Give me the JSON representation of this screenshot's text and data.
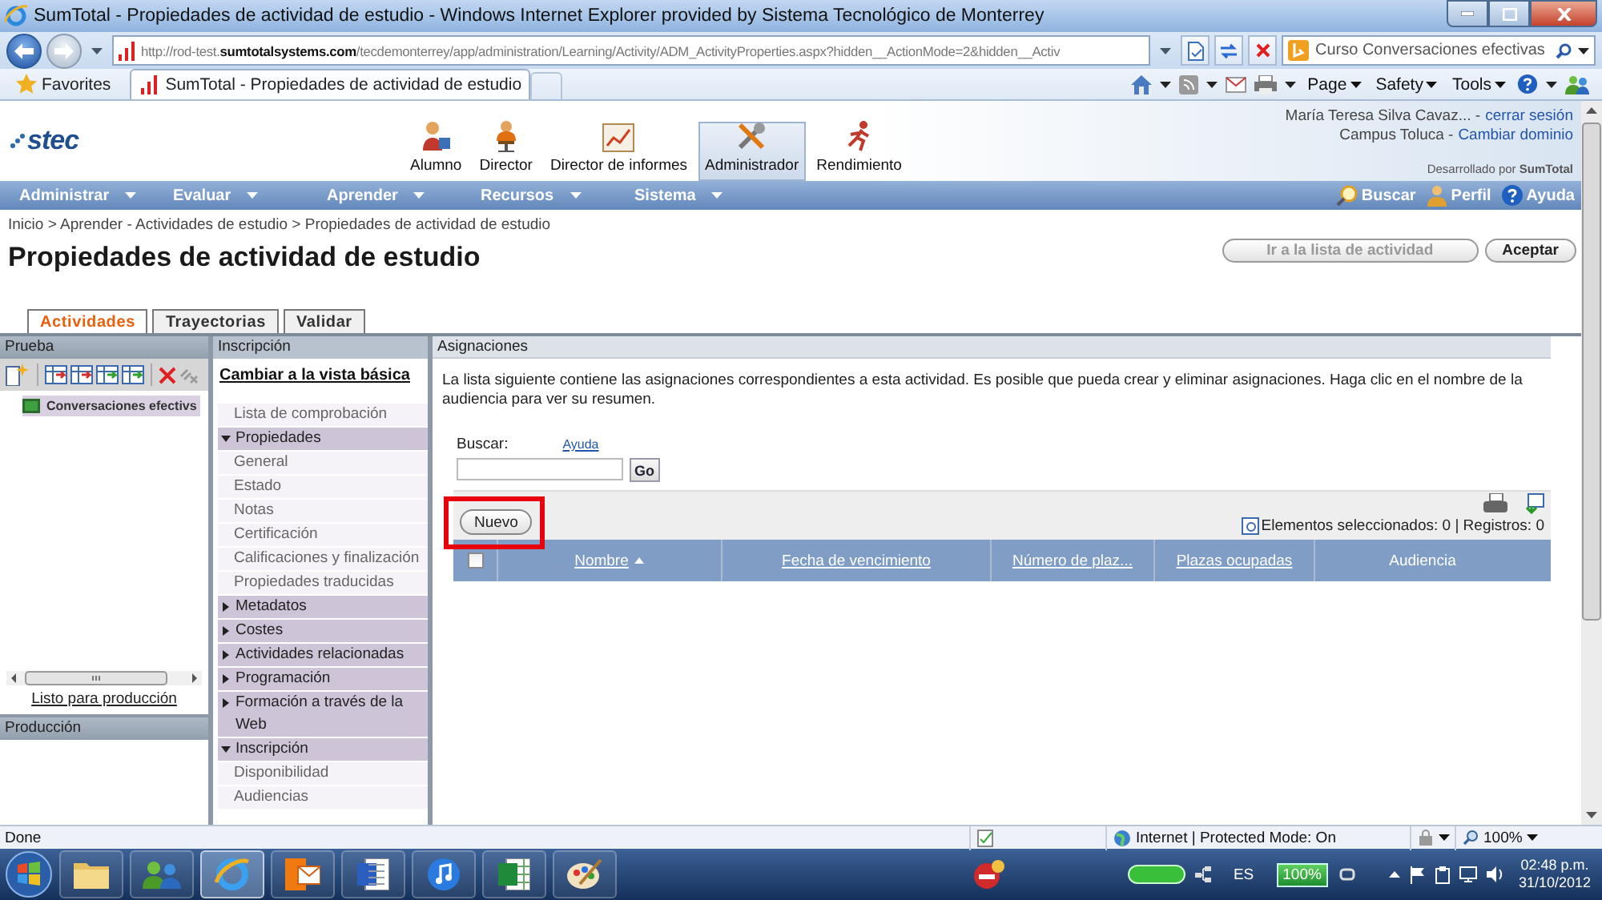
{
  "window": {
    "title": "SumTotal - Propiedades de actividad de estudio - Windows Internet Explorer provided by Sistema Tecnológico de Monterrey"
  },
  "address_bar": {
    "url": "http://rod-test.**sumtotalsystems.com**/tecdemonterrey/app/administration/Learning/Activity/ADM_ActivityProperties.aspx?hidden__ActionMode=2&hidden__Activ"
  },
  "search_box": {
    "value": "Curso Conversaciones efectivas"
  },
  "favorites": {
    "label": "Favorites"
  },
  "browser_tabs": [
    {
      "title": "SumTotal - Propiedades de actividad de estudio",
      "selected": true
    }
  ],
  "command_bar": [
    {
      "label": "Page"
    },
    {
      "label": "Safety"
    },
    {
      "label": "Tools"
    }
  ],
  "header": {
    "logo": "stec",
    "roles": [
      {
        "kind": "learner",
        "label": "Alumno",
        "selected": false
      },
      {
        "kind": "director",
        "label": "Director",
        "selected": false
      },
      {
        "kind": "reports",
        "label": "Director de informes",
        "selected": false
      },
      {
        "kind": "admin",
        "label": "Administrador",
        "selected": true
      },
      {
        "kind": "performance",
        "label": "Rendimiento",
        "selected": false
      }
    ],
    "user_name": "María Teresa Silva Cavaz... -",
    "logout": "cerrar sesión",
    "campus": "Campus Toluca -",
    "change_domain": "Cambiar dominio",
    "powered_by": "Desarrollado por **SumTotal**"
  },
  "nav_menu": [
    {
      "label": "Administrar"
    },
    {
      "label": "Evaluar"
    },
    {
      "label": "Aprender"
    },
    {
      "label": "Recursos"
    },
    {
      "label": "Sistema"
    }
  ],
  "nav_tools": [
    {
      "kind": "search",
      "label": "Buscar"
    },
    {
      "kind": "profile",
      "label": "Perfil"
    },
    {
      "kind": "help",
      "label": "Ayuda"
    }
  ],
  "breadcrumb": "Inicio > Aprender - Actividades de estudio > Propiedades de actividad de estudio",
  "page_title": "Propiedades de actividad de estudio",
  "page_buttons": [
    {
      "label": "Ir a la lista de actividad",
      "disabled": true
    },
    {
      "label": "Aceptar",
      "disabled": false
    }
  ],
  "tabs": [
    {
      "label": "Actividades",
      "selected": true
    },
    {
      "label": "Trayectorias",
      "selected": false
    },
    {
      "label": "Validar",
      "selected": false
    }
  ],
  "test_panel": {
    "title": "Prueba",
    "tree": [
      {
        "label": "Conversaciones efectivs",
        "selected": true
      }
    ],
    "link": "Listo para producción"
  },
  "production_panel": {
    "title": "Producción"
  },
  "section_panel": {
    "title": "Inscripción",
    "switch_link": "Cambiar a la vista básica",
    "items": [
      {
        "kind": "link",
        "label": "Lista de comprobación"
      },
      {
        "kind": "section",
        "label": "Propiedades",
        "expanded": true,
        "children": [
          {
            "label": "General"
          },
          {
            "label": "Estado"
          },
          {
            "label": "Notas"
          },
          {
            "label": "Certificación"
          },
          {
            "label": "Calificaciones y finalización"
          },
          {
            "label": "Propiedades traducidas"
          }
        ]
      },
      {
        "kind": "section",
        "label": "Metadatos",
        "expanded": false
      },
      {
        "kind": "section",
        "label": "Costes",
        "expanded": false
      },
      {
        "kind": "section",
        "label": "Actividades relacionadas",
        "expanded": false
      },
      {
        "kind": "section",
        "label": "Programación",
        "expanded": false
      },
      {
        "kind": "section",
        "label": "Formación a través de la Web",
        "expanded": false
      },
      {
        "kind": "section",
        "label": "Inscripción",
        "expanded": true,
        "children": [
          {
            "label": "Disponibilidad"
          },
          {
            "label": "Audiencias"
          }
        ]
      }
    ]
  },
  "assignments": {
    "title": "Asignaciones",
    "description": "La lista siguiente contiene las asignaciones correspondientes a esta actividad. Es posible que pueda crear y eliminar asignaciones. Haga clic en el nombre de la audiencia para ver su resumen.",
    "search_label": "Buscar:",
    "help_link": "Ayuda",
    "go_button": "Go",
    "new_button": {
      "label": "Nuevo",
      "highlighted": true
    },
    "selection_info": "Elementos seleccionados: 0 | Registros: 0",
    "select_all": {
      "checked": false
    },
    "columns": [
      {
        "label": "Nombre",
        "link": true,
        "sorted": true
      },
      {
        "label": "Fecha de vencimiento",
        "link": true,
        "sorted": false
      },
      {
        "label": "Número de plaz...",
        "link": true,
        "sorted": false
      },
      {
        "label": "Plazas ocupadas",
        "link": true,
        "sorted": false
      },
      {
        "label": "Audiencia",
        "link": false,
        "sorted": false
      }
    ]
  },
  "status_bar": {
    "text": "Done",
    "zone": "Internet | Protected Mode: On",
    "zoom": "100%"
  },
  "taskbar": {
    "apps": [
      {
        "kind": "folder",
        "active": false
      },
      {
        "kind": "people",
        "active": false
      },
      {
        "kind": "browser",
        "active": true
      },
      {
        "kind": "mail",
        "active": false
      },
      {
        "kind": "word",
        "active": false
      },
      {
        "kind": "music",
        "active": false
      },
      {
        "kind": "sheet",
        "active": false
      },
      {
        "kind": "paint",
        "active": false
      }
    ],
    "language": "ES",
    "battery": "100%",
    "time": "02:48 p.m.",
    "date": "31/10/2012"
  }
}
